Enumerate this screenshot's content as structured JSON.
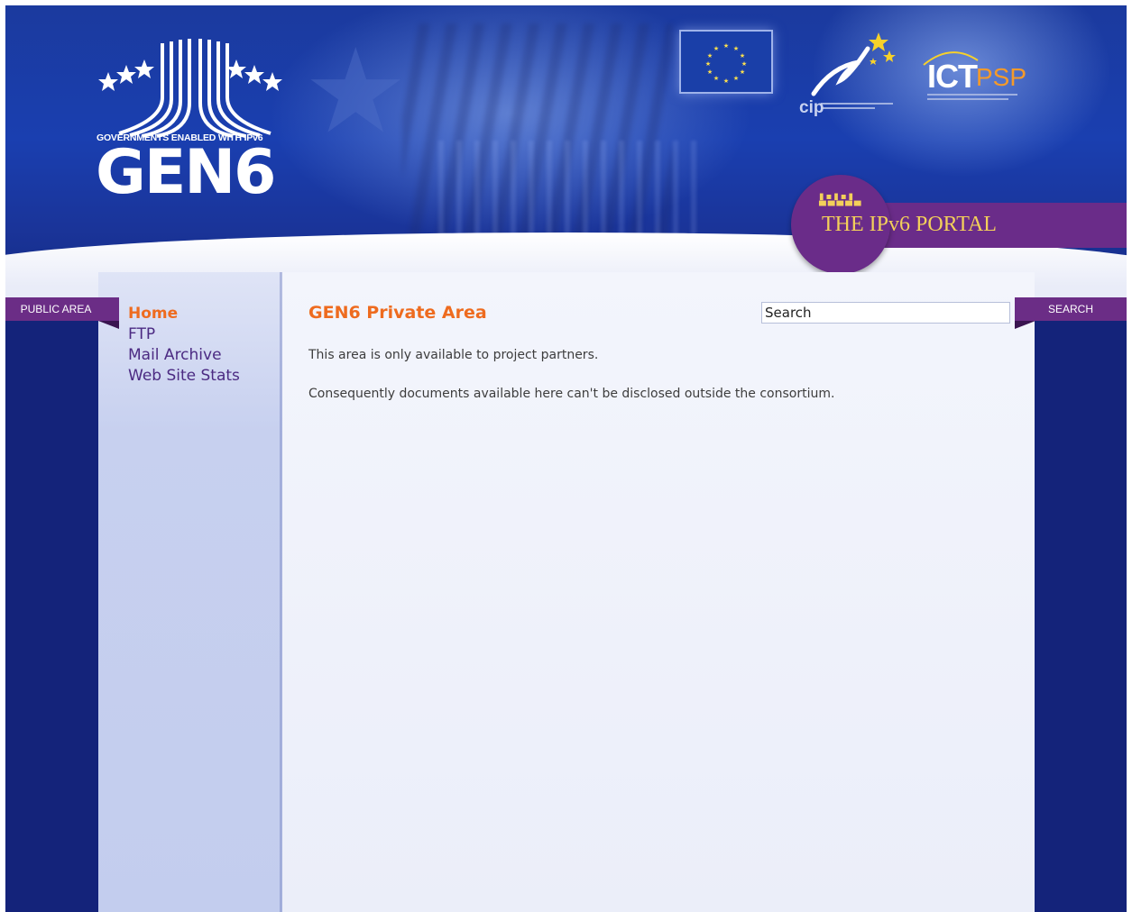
{
  "header": {
    "gen6_tagline": "GOVERNMENTS ENABLED WITH IPv6",
    "gen6_name": "GEN6",
    "cip_text": "cip",
    "ictpsp_ict": "ICT",
    "ictpsp_psp": "PSP",
    "ipv6_portal": "THE IPv6 PORTAL"
  },
  "ribbons": {
    "public_area": "PUBLIC AREA",
    "search": "SEARCH"
  },
  "search": {
    "value": "Search"
  },
  "sidebar": {
    "items": [
      {
        "label": "Home",
        "active": true
      },
      {
        "label": "FTP"
      },
      {
        "label": "Mail Archive"
      },
      {
        "label": "Web Site Stats"
      }
    ]
  },
  "main": {
    "title": "GEN6 Private Area",
    "paragraphs": [
      "This area is only available to project partners.",
      "Consequently documents available here can't be disclosed outside the consortium."
    ]
  },
  "colors": {
    "header_blue": "#1a3fb0",
    "page_navy": "#14237a",
    "accent_orange": "#ee6b1f",
    "ribbon_purple": "#6b2d86",
    "nav_link_purple": "#4b2a82",
    "portal_gold": "#f3d05a"
  },
  "icons": [
    "gen6-logo",
    "eu-flag-icon",
    "cip-logo",
    "ictpsp-logo",
    "ipv6-portal-logo"
  ]
}
